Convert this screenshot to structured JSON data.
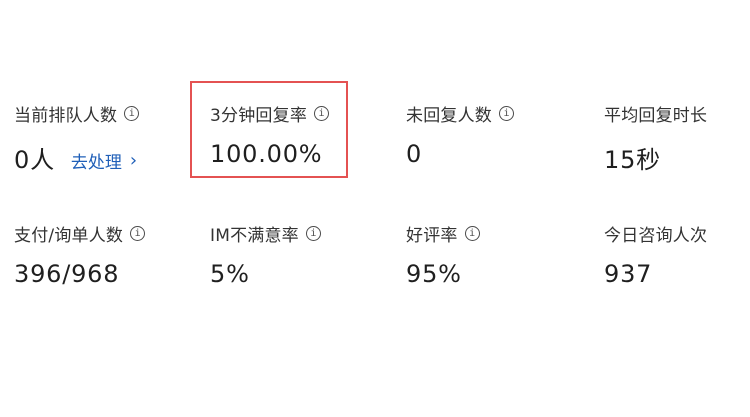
{
  "metrics": [
    {
      "label": "当前排队人数",
      "value": "0人",
      "action": "去处理",
      "icon": "info-icon",
      "action_icon": "chevron-right-icon"
    },
    {
      "label": "3分钟回复率",
      "value": "100.00%",
      "icon": "info-icon"
    },
    {
      "label": "未回复人数",
      "value": "0",
      "icon": "info-icon"
    },
    {
      "label": "平均回复时长",
      "value": "15秒",
      "icon": "info-icon"
    },
    {
      "label": "支付/询单人数",
      "value": "396/968",
      "icon": "info-icon"
    },
    {
      "label": "IM不满意率",
      "value": "5%",
      "icon": "info-icon"
    },
    {
      "label": "好评率",
      "value": "95%",
      "icon": "info-icon"
    },
    {
      "label": "今日咨询人次",
      "value": "937",
      "icon": "info-icon"
    }
  ],
  "highlight_color": "#e45252",
  "link_color": "#1f5fb8"
}
